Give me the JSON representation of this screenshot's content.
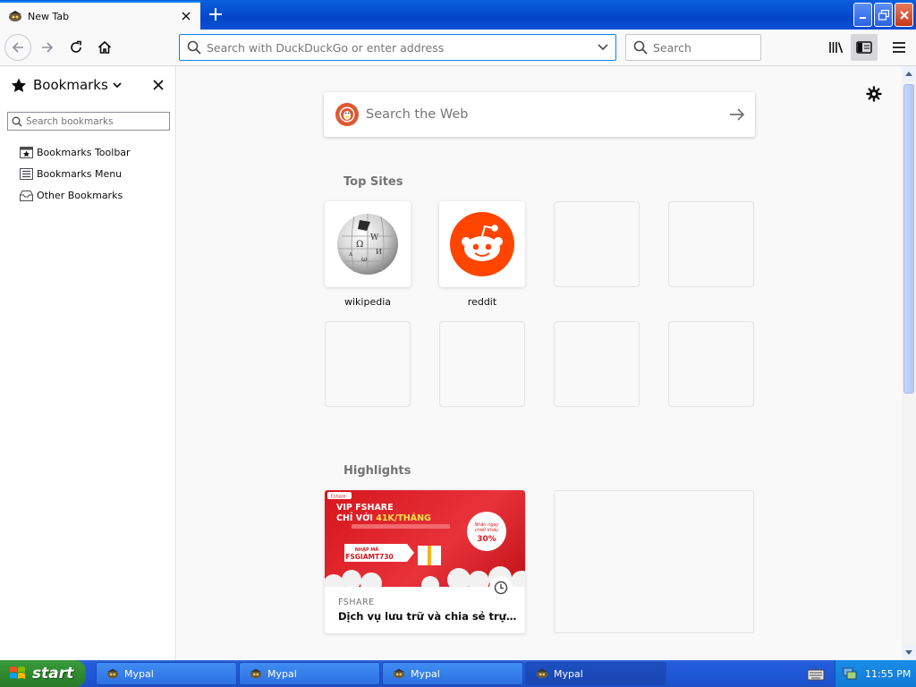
{
  "window": {
    "tab_title": "New Tab"
  },
  "navbar": {
    "url_placeholder": "Search with DuckDuckGo or enter address",
    "search_placeholder": "Search"
  },
  "sidebar": {
    "title": "Bookmarks",
    "search_placeholder": "Search bookmarks",
    "items": [
      {
        "label": "Bookmarks Toolbar",
        "icon": "bookmarks-toolbar-icon"
      },
      {
        "label": "Bookmarks Menu",
        "icon": "bookmarks-menu-icon"
      },
      {
        "label": "Other Bookmarks",
        "icon": "folder-icon"
      }
    ]
  },
  "newtab": {
    "search_placeholder": "Search the Web",
    "top_sites_title": "Top Sites",
    "top_sites": [
      {
        "label": "wikipedia"
      },
      {
        "label": "reddit"
      }
    ],
    "highlights_title": "Highlights",
    "highlight": {
      "source": "FSHARE",
      "title": "Dịch vụ lưu trữ và chia sẻ trực t...",
      "banner": {
        "brand": "Fshare",
        "line1": "VIP FSHARE",
        "line2_pre": "CHỈ VỚI ",
        "line2_hl": "41K/THÁNG",
        "code_label": "NHẬP MÃ",
        "code": "FSGIAMT730",
        "discount_top": "Nhận ngay",
        "discount_mid": "chiết khấu",
        "discount_pct": "30%"
      }
    }
  },
  "taskbar": {
    "start_label": "start",
    "tasks": [
      {
        "label": "Mypal"
      },
      {
        "label": "Mypal"
      },
      {
        "label": "Mypal"
      },
      {
        "label": "Mypal"
      }
    ],
    "clock": "11:55 PM"
  },
  "colors": {
    "accent": "#0a84ff",
    "xp_blue": "#245ddb",
    "start_green": "#2f8a2f",
    "reddit": "#ff4500",
    "ddg": "#de5833",
    "fshare_red": "#d6161d"
  }
}
